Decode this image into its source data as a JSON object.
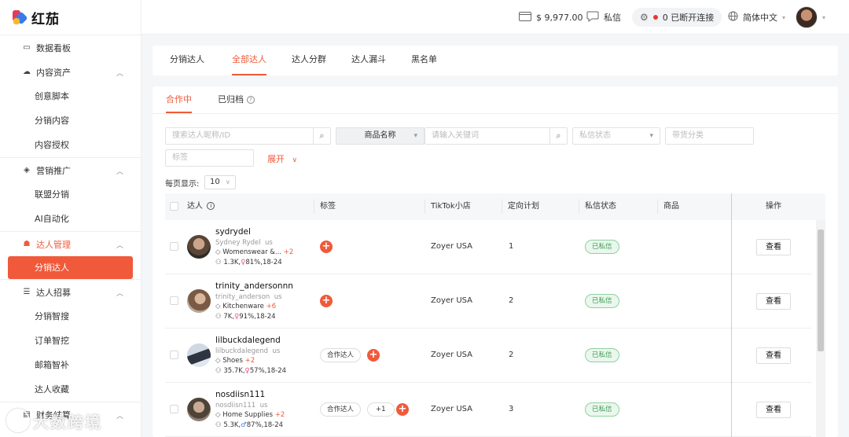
{
  "brand": {
    "name": "红茄"
  },
  "sidebar": {
    "items": [
      {
        "type": "group",
        "label": "数据看板",
        "icon": "monitor-icon"
      },
      {
        "type": "group",
        "label": "内容资产",
        "icon": "cloud-icon",
        "expanded": true
      },
      {
        "type": "sub",
        "label": "创意脚本"
      },
      {
        "type": "sub",
        "label": "分销内容"
      },
      {
        "type": "sub",
        "label": "内容授权"
      },
      {
        "type": "group",
        "label": "营销推广",
        "icon": "cube-icon",
        "expanded": true
      },
      {
        "type": "sub",
        "label": "联盟分销"
      },
      {
        "type": "sub",
        "label": "AI自动化"
      },
      {
        "type": "group",
        "label": "达人管理",
        "icon": "people-icon",
        "expanded": true,
        "active": true
      },
      {
        "type": "sub",
        "label": "分销达人",
        "selected": true
      },
      {
        "type": "group",
        "label": "达人招募",
        "icon": "list-icon",
        "expanded": true
      },
      {
        "type": "sub",
        "label": "分销智搜"
      },
      {
        "type": "sub",
        "label": "订单智挖"
      },
      {
        "type": "sub",
        "label": "邮箱智补"
      },
      {
        "type": "sub",
        "label": "达人收藏"
      },
      {
        "type": "group",
        "label": "财务结算",
        "icon": "wallet-icon",
        "expanded": true
      }
    ],
    "watermark": "大数跨境"
  },
  "topbar": {
    "balance": "$ 9,977.00",
    "messages": "私信",
    "connection": "0 已断开连接",
    "language": "简体中文"
  },
  "tabs": [
    "分销达人",
    "全部达人",
    "达人分群",
    "达人漏斗",
    "黑名单"
  ],
  "active_tab_index": 1,
  "subtabs": {
    "cooperating": "合作中",
    "archived": "已归档"
  },
  "filters": {
    "search_placeholder": "搜索达人昵称/ID",
    "product_select": "商品名称",
    "keyword_placeholder": "请输入关键词",
    "dm_status_placeholder": "私信状态",
    "category_placeholder": "带货分类",
    "tag_placeholder": "标签",
    "expand_label": "展开"
  },
  "pagination": {
    "label": "每页显示:",
    "per_page": "10"
  },
  "table": {
    "headers": [
      "达人",
      "标签",
      "TikTok小店",
      "定向计划",
      "私信状态",
      "商品",
      "操作"
    ],
    "rows": [
      {
        "name": "sydrydel",
        "handle": "Sydney Rydel",
        "region": "us",
        "category": "Womenswear &...",
        "category_more": "+2",
        "followers": "1.3K,",
        "audience": "81%,18-24",
        "gender": "female",
        "tags": [],
        "tags_more": "",
        "shop": "Zoyer USA",
        "plan": "1",
        "dm_status": "已私信",
        "view_label": "查看"
      },
      {
        "name": "trinity_andersonnn",
        "handle": "trinity_anderson",
        "region": "us",
        "category": "Kitchenware",
        "category_more": "+6",
        "followers": "7K,",
        "audience": "91%,18-24",
        "gender": "female",
        "tags": [],
        "tags_more": "",
        "shop": "Zoyer USA",
        "plan": "2",
        "dm_status": "已私信",
        "view_label": "查看"
      },
      {
        "name": "lilbuckdalegend",
        "handle": "lilbuckdalegend",
        "region": "us",
        "category": "Shoes",
        "category_more": "+2",
        "followers": "35.7K,",
        "audience": "57%,18-24",
        "gender": "female",
        "tags": [
          "合作达人"
        ],
        "tags_more": "",
        "shop": "Zoyer USA",
        "plan": "2",
        "dm_status": "已私信",
        "view_label": "查看"
      },
      {
        "name": "nosdiisn111",
        "handle": "nosdiisn111",
        "region": "us",
        "category": "Home Supplies",
        "category_more": "+2",
        "followers": "5.3K,",
        "audience": "87%,18-24",
        "gender": "male",
        "tags": [
          "合作达人"
        ],
        "tags_more": "+1",
        "shop": "Zoyer USA",
        "plan": "3",
        "dm_status": "已私信",
        "view_label": "查看"
      }
    ]
  },
  "colors": {
    "accent": "#f05a3a",
    "success": "#3c9a54",
    "female": "#e84a8a",
    "male": "#3b7be8"
  }
}
